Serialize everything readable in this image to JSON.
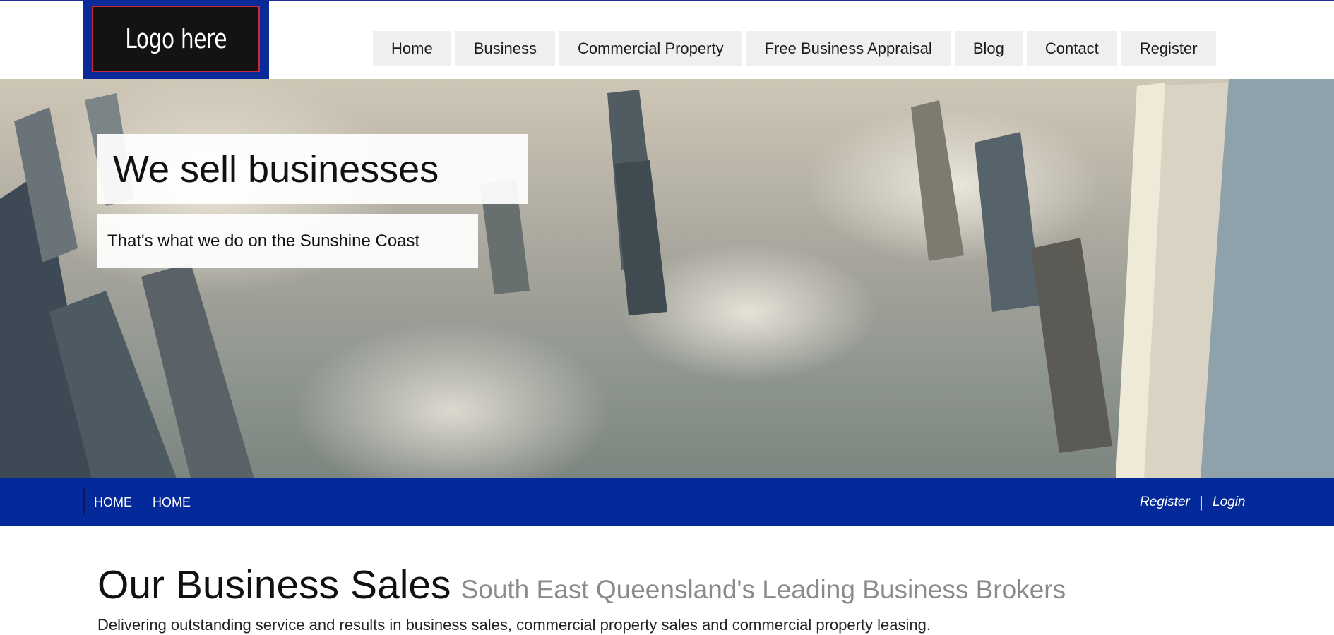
{
  "logo": {
    "text": "Logo here"
  },
  "nav": {
    "items": [
      {
        "label": "Home"
      },
      {
        "label": "Business"
      },
      {
        "label": "Commercial Property"
      },
      {
        "label": "Free Business Appraisal"
      },
      {
        "label": "Blog"
      },
      {
        "label": "Contact"
      },
      {
        "label": "Register"
      }
    ]
  },
  "hero": {
    "title": "We sell businesses",
    "subtitle": "That's what we do on the Sunshine Coast",
    "image_description_icon": "city-skyline-in-fog-image"
  },
  "breadcrumb": {
    "items": [
      "HOME",
      "HOME"
    ]
  },
  "auth": {
    "register": "Register",
    "separator": "|",
    "login": "Login"
  },
  "intro": {
    "title": "Our Business Sales",
    "tagline": "South East Queensland's Leading Business Brokers",
    "description": "Delivering outstanding service and results in business sales, commercial property sales and commercial property leasing."
  },
  "colors": {
    "brand_blue": "#04299b",
    "logo_bg": "#151213",
    "logo_border": "#c8283a",
    "nav_bg": "#efefef"
  }
}
